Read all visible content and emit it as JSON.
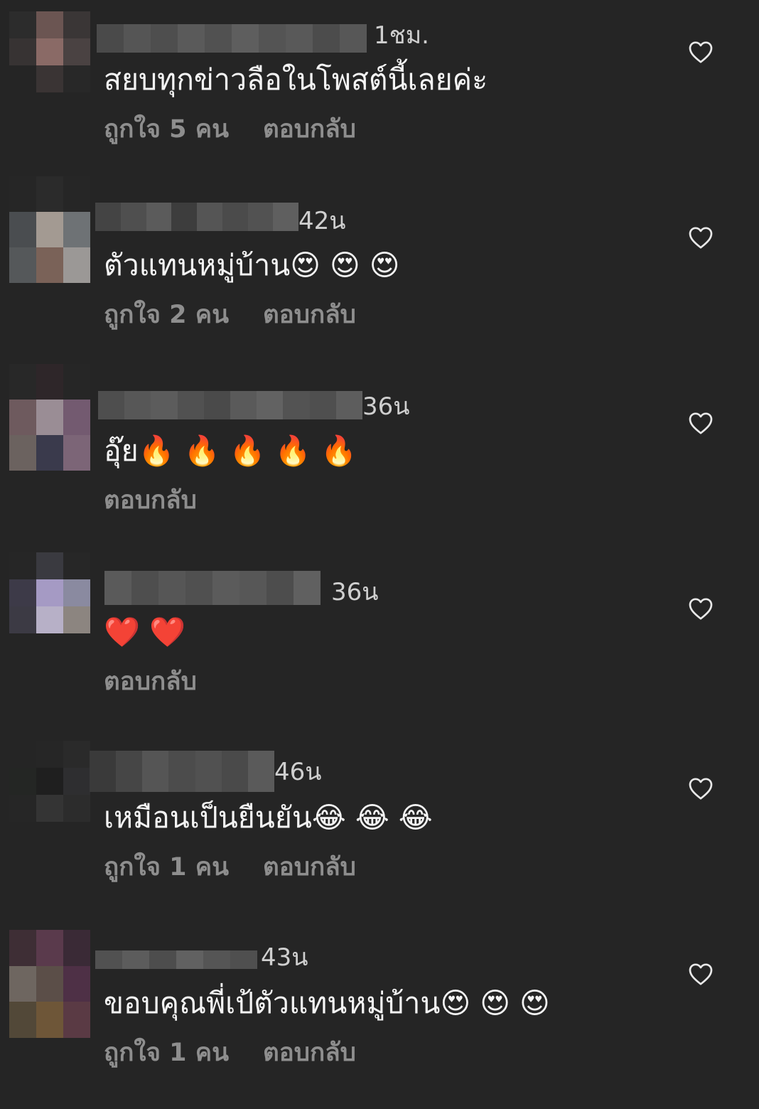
{
  "comments": [
    {
      "time": "1ชม.",
      "text": "สยบทุกข่าวลือในโพสต์นี้เลยค่ะ",
      "likes": "ถูกใจ 5 คน",
      "reply": "ตอบกลับ"
    },
    {
      "time": "42น",
      "text": "ตัวแทนหมู่บ้าน😍 😍 😍",
      "likes": "ถูกใจ 2 คน",
      "reply": "ตอบกลับ"
    },
    {
      "time": "36น",
      "text": "อุ๊ย🔥 🔥 🔥 🔥 🔥",
      "likes": "",
      "reply": "ตอบกลับ"
    },
    {
      "time": "36น",
      "text": "❤️ ❤️",
      "likes": "",
      "reply": "ตอบกลับ"
    },
    {
      "time": "46น",
      "text": "เหมือนเป็นยืนยัน😂 😂 😂",
      "likes": "ถูกใจ 1 คน",
      "reply": "ตอบกลับ"
    },
    {
      "time": "43น",
      "text": "ขอบคุณพี่เป้ตัวแทนหมู่บ้าน😍 😍 😍",
      "likes": "ถูกใจ 1 คน",
      "reply": "ตอบกลับ"
    }
  ],
  "icons": {
    "like": "heart-outline-icon"
  },
  "colors": {
    "background": "#252525",
    "text": "#f4f4f4",
    "muted": "#8e8e8e"
  }
}
